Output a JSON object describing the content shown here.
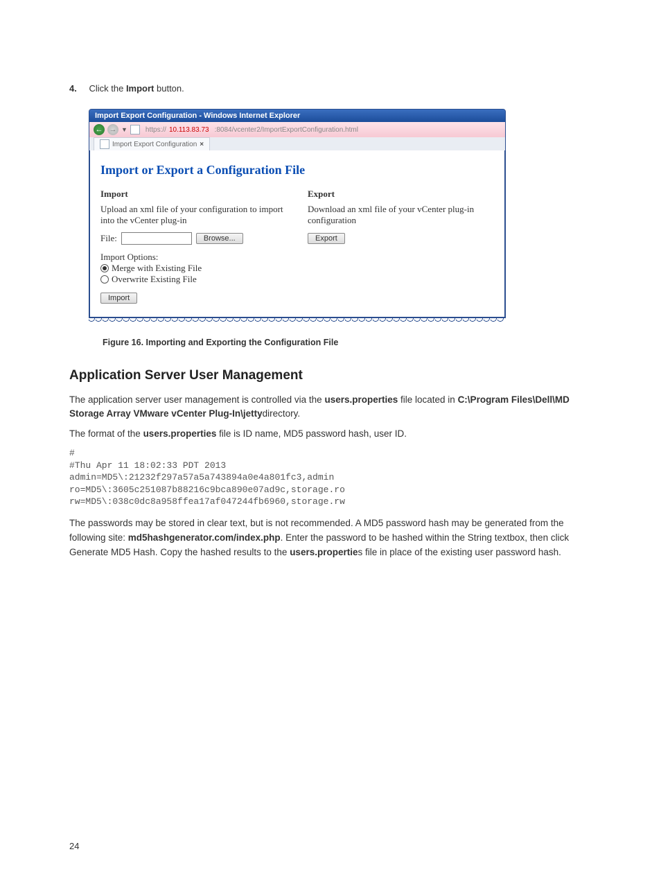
{
  "step": {
    "num": "4.",
    "prefix": "Click the ",
    "bold": "Import",
    "suffix": " button."
  },
  "browser": {
    "title": "Import Export Configuration - Windows Internet Explorer",
    "url_prefix": "https://",
    "url_host": "10.113.83.73",
    "url_rest": ":8084/vcenter2/ImportExportConfiguration.html",
    "tab_label": "Import Export Configuration",
    "tab_close": "×",
    "heading": "Import or Export a Configuration File",
    "import": {
      "title": "Import",
      "desc": "Upload an xml file of your configuration to import into the vCenter plug-in",
      "file_label": "File:",
      "browse": "Browse...",
      "opts_label": "Import Options:",
      "opt_merge": "Merge with Existing File",
      "opt_overwrite": "Overwrite Existing File",
      "btn": "Import"
    },
    "export": {
      "title": "Export",
      "desc": "Download an xml file of your vCenter plug-in configuration",
      "btn": "Export"
    }
  },
  "figure_caption": "Figure 16. Importing and Exporting the Configuration File",
  "section_heading": "Application Server User Management",
  "para1": {
    "a": "The application server user management is controlled via the ",
    "b": "users.properties",
    "c": " file located in ",
    "d": "C:\\Program Files\\Dell\\MD Storage Array VMware vCenter Plug-In\\jetty",
    "e": "directory."
  },
  "para2": {
    "a": "The format of the ",
    "b": "users.properties",
    "c": " file is ID name, MD5 password hash, user ID."
  },
  "code": "#\n#Thu Apr 11 18:02:33 PDT 2013\nadmin=MD5\\:21232f297a57a5a743894a0e4a801fc3,admin\nro=MD5\\:3605c251087b88216c9bca890e07ad9c,storage.ro\nrw=MD5\\:038c0dc8a958ffea17af047244fb6960,storage.rw",
  "para3": {
    "a": "The passwords may be stored in clear text, but is not recommended. A MD5 password hash may be generated from the following site: ",
    "b": "md5hashgenerator.com/index.php",
    "c": ". Enter the password to be hashed within the String textbox, then click Generate MD5 Hash. Copy the hashed results to the ",
    "d": "users.propertie",
    "e": "s file in place of the existing user password hash."
  },
  "page_number": "24"
}
